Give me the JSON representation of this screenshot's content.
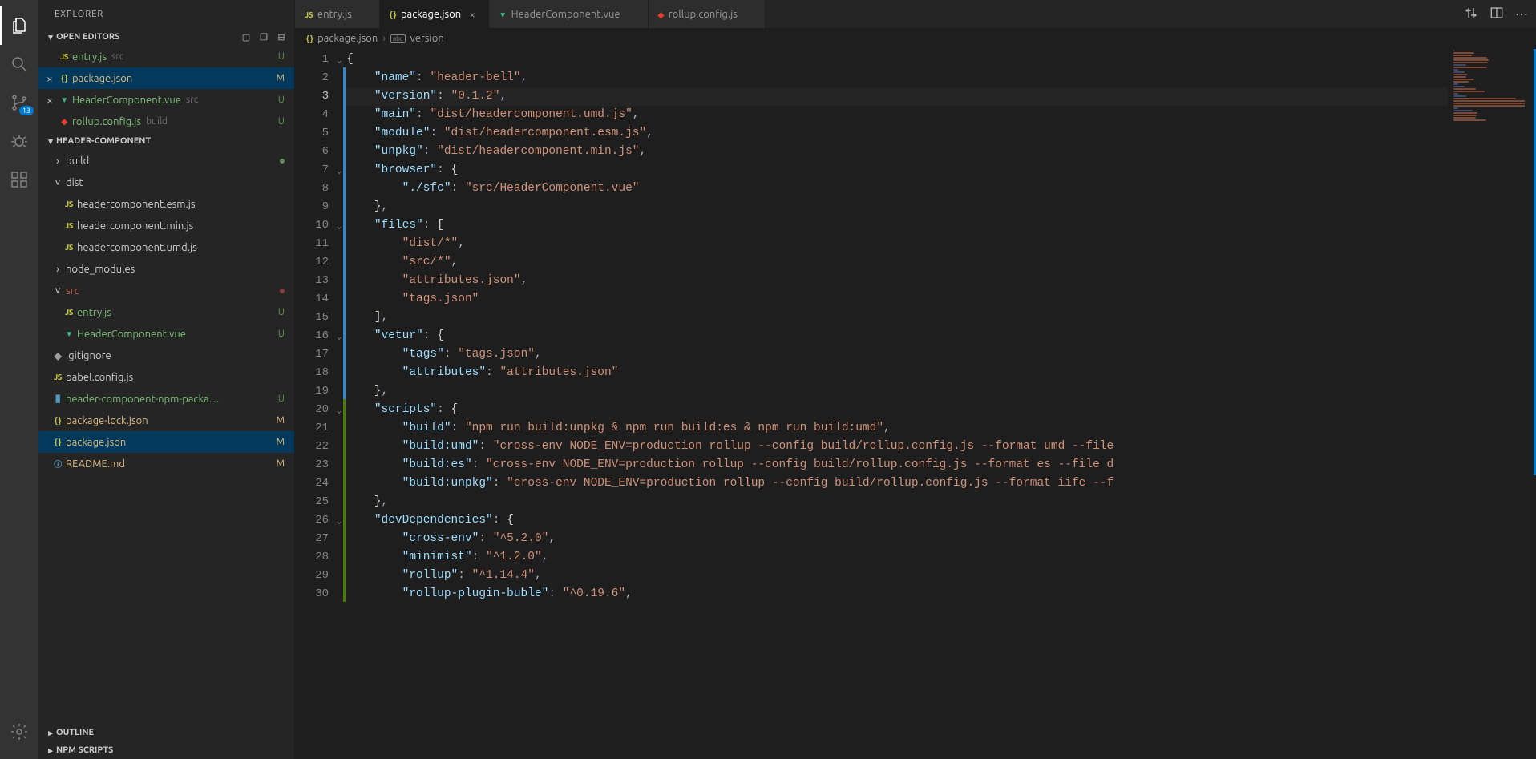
{
  "sidebar": {
    "title": "EXPLORER",
    "sections": {
      "openEditors": {
        "label": "OPEN EDITORS",
        "items": [
          {
            "icon": "js",
            "label": "entry.js",
            "hint": "src",
            "status": "U",
            "close": false
          },
          {
            "icon": "json",
            "label": "package.json",
            "hint": "",
            "status": "M",
            "close": true
          },
          {
            "icon": "vue",
            "label": "HeaderComponent.vue",
            "hint": "src",
            "status": "U",
            "close": true
          },
          {
            "icon": "rollup",
            "label": "rollup.config.js",
            "hint": "build",
            "status": "U",
            "close": false
          }
        ]
      },
      "project": {
        "label": "HEADER-COMPONENT",
        "tree": [
          {
            "depth": 0,
            "kind": "folder-closed",
            "label": "build",
            "statusKind": "dot-green"
          },
          {
            "depth": 0,
            "kind": "folder-open",
            "label": "dist"
          },
          {
            "depth": 1,
            "kind": "file",
            "icon": "js",
            "label": "headercomponent.esm.js"
          },
          {
            "depth": 1,
            "kind": "file",
            "icon": "js",
            "label": "headercomponent.min.js"
          },
          {
            "depth": 1,
            "kind": "file",
            "icon": "js",
            "label": "headercomponent.umd.js"
          },
          {
            "depth": 0,
            "kind": "folder-closed",
            "label": "node_modules"
          },
          {
            "depth": 0,
            "kind": "folder-open",
            "label": "src",
            "color": "maroon",
            "statusKind": "dot-maroon"
          },
          {
            "depth": 1,
            "kind": "file",
            "icon": "js",
            "label": "entry.js",
            "color": "green",
            "status": "U"
          },
          {
            "depth": 1,
            "kind": "file",
            "icon": "vue",
            "label": "HeaderComponent.vue",
            "color": "green",
            "status": "U"
          },
          {
            "depth": 0,
            "kind": "file",
            "icon": "git",
            "label": ".gitignore"
          },
          {
            "depth": 0,
            "kind": "file",
            "icon": "js",
            "label": "babel.config.js"
          },
          {
            "depth": 0,
            "kind": "file",
            "icon": "md",
            "label": "header-component-npm-packa…",
            "color": "green",
            "status": "U"
          },
          {
            "depth": 0,
            "kind": "file",
            "icon": "json",
            "label": "package-lock.json",
            "color": "amber",
            "status": "M"
          },
          {
            "depth": 0,
            "kind": "file",
            "icon": "json",
            "label": "package.json",
            "color": "amber",
            "status": "M",
            "selected": true
          },
          {
            "depth": 0,
            "kind": "file",
            "icon": "info",
            "label": "README.md",
            "color": "amber",
            "status": "M"
          }
        ]
      },
      "outline": {
        "label": "OUTLINE"
      },
      "npmScripts": {
        "label": "NPM SCRIPTS"
      }
    }
  },
  "activityBar": {
    "scmBadge": "13"
  },
  "tabs": [
    {
      "icon": "js",
      "label": "entry.js",
      "active": false,
      "close": false
    },
    {
      "icon": "json",
      "label": "package.json",
      "active": true,
      "close": true
    },
    {
      "icon": "vue",
      "label": "HeaderComponent.vue",
      "active": false,
      "close": false
    },
    {
      "icon": "rollup",
      "label": "rollup.config.js",
      "active": false,
      "close": false
    }
  ],
  "breadcrumb": {
    "fileIcon": "json",
    "file": "package.json",
    "symbolIcon": "abc",
    "symbol": "version"
  },
  "code": {
    "firstLine": 1,
    "currentLine": 3,
    "dirtyBar": [
      {
        "from": 2,
        "to": 19,
        "color": "#2e8ad0"
      },
      {
        "from": 20,
        "to": 30,
        "color": "#487e02"
      }
    ],
    "lines": [
      [
        [
          "br",
          "{"
        ]
      ],
      [
        [
          "br",
          "    "
        ],
        [
          "k",
          "\"name\""
        ],
        [
          "p",
          ": "
        ],
        [
          "s",
          "\"header-bell\""
        ],
        [
          "p",
          ","
        ]
      ],
      [
        [
          "br",
          "    "
        ],
        [
          "k",
          "\"version\""
        ],
        [
          "p",
          ": "
        ],
        [
          "s",
          "\"0.1.2\""
        ],
        [
          "p",
          ","
        ]
      ],
      [
        [
          "br",
          "    "
        ],
        [
          "k",
          "\"main\""
        ],
        [
          "p",
          ": "
        ],
        [
          "s",
          "\"dist/headercomponent.umd.js\""
        ],
        [
          "p",
          ","
        ]
      ],
      [
        [
          "br",
          "    "
        ],
        [
          "k",
          "\"module\""
        ],
        [
          "p",
          ": "
        ],
        [
          "s",
          "\"dist/headercomponent.esm.js\""
        ],
        [
          "p",
          ","
        ]
      ],
      [
        [
          "br",
          "    "
        ],
        [
          "k",
          "\"unpkg\""
        ],
        [
          "p",
          ": "
        ],
        [
          "s",
          "\"dist/headercomponent.min.js\""
        ],
        [
          "p",
          ","
        ]
      ],
      [
        [
          "br",
          "    "
        ],
        [
          "k",
          "\"browser\""
        ],
        [
          "p",
          ": "
        ],
        [
          "br",
          "{"
        ]
      ],
      [
        [
          "br",
          "        "
        ],
        [
          "k",
          "\"./sfc\""
        ],
        [
          "p",
          ": "
        ],
        [
          "s",
          "\"src/HeaderComponent.vue\""
        ]
      ],
      [
        [
          "br",
          "    "
        ],
        [
          "br",
          "}"
        ],
        [
          "p",
          ","
        ]
      ],
      [
        [
          "br",
          "    "
        ],
        [
          "k",
          "\"files\""
        ],
        [
          "p",
          ": "
        ],
        [
          "br",
          "["
        ]
      ],
      [
        [
          "br",
          "        "
        ],
        [
          "s",
          "\"dist/*\""
        ],
        [
          "p",
          ","
        ]
      ],
      [
        [
          "br",
          "        "
        ],
        [
          "s",
          "\"src/*\""
        ],
        [
          "p",
          ","
        ]
      ],
      [
        [
          "br",
          "        "
        ],
        [
          "s",
          "\"attributes.json\""
        ],
        [
          "p",
          ","
        ]
      ],
      [
        [
          "br",
          "        "
        ],
        [
          "s",
          "\"tags.json\""
        ]
      ],
      [
        [
          "br",
          "    "
        ],
        [
          "br",
          "]"
        ],
        [
          "p",
          ","
        ]
      ],
      [
        [
          "br",
          "    "
        ],
        [
          "k",
          "\"vetur\""
        ],
        [
          "p",
          ": "
        ],
        [
          "br",
          "{"
        ]
      ],
      [
        [
          "br",
          "        "
        ],
        [
          "k",
          "\"tags\""
        ],
        [
          "p",
          ": "
        ],
        [
          "s",
          "\"tags.json\""
        ],
        [
          "p",
          ","
        ]
      ],
      [
        [
          "br",
          "        "
        ],
        [
          "k",
          "\"attributes\""
        ],
        [
          "p",
          ": "
        ],
        [
          "s",
          "\"attributes.json\""
        ]
      ],
      [
        [
          "br",
          "    "
        ],
        [
          "br",
          "}"
        ],
        [
          "p",
          ","
        ]
      ],
      [
        [
          "br",
          "    "
        ],
        [
          "k",
          "\"scripts\""
        ],
        [
          "p",
          ": "
        ],
        [
          "br",
          "{"
        ]
      ],
      [
        [
          "br",
          "        "
        ],
        [
          "k",
          "\"build\""
        ],
        [
          "p",
          ": "
        ],
        [
          "s",
          "\"npm run build:unpkg & npm run build:es & npm run build:umd\""
        ],
        [
          "p",
          ","
        ]
      ],
      [
        [
          "br",
          "        "
        ],
        [
          "k",
          "\"build:umd\""
        ],
        [
          "p",
          ": "
        ],
        [
          "s",
          "\"cross-env NODE_ENV=production rollup --config build/rollup.config.js --format umd --file "
        ]
      ],
      [
        [
          "br",
          "        "
        ],
        [
          "k",
          "\"build:es\""
        ],
        [
          "p",
          ": "
        ],
        [
          "s",
          "\"cross-env NODE_ENV=production rollup --config build/rollup.config.js --format es --file d"
        ]
      ],
      [
        [
          "br",
          "        "
        ],
        [
          "k",
          "\"build:unpkg\""
        ],
        [
          "p",
          ": "
        ],
        [
          "s",
          "\"cross-env NODE_ENV=production rollup --config build/rollup.config.js --format iife --f"
        ]
      ],
      [
        [
          "br",
          "    "
        ],
        [
          "br",
          "}"
        ],
        [
          "p",
          ","
        ]
      ],
      [
        [
          "br",
          "    "
        ],
        [
          "k",
          "\"devDependencies\""
        ],
        [
          "p",
          ": "
        ],
        [
          "br",
          "{"
        ]
      ],
      [
        [
          "br",
          "        "
        ],
        [
          "k",
          "\"cross-env\""
        ],
        [
          "p",
          ": "
        ],
        [
          "s",
          "\"^5.2.0\""
        ],
        [
          "p",
          ","
        ]
      ],
      [
        [
          "br",
          "        "
        ],
        [
          "k",
          "\"minimist\""
        ],
        [
          "p",
          ": "
        ],
        [
          "s",
          "\"^1.2.0\""
        ],
        [
          "p",
          ","
        ]
      ],
      [
        [
          "br",
          "        "
        ],
        [
          "k",
          "\"rollup\""
        ],
        [
          "p",
          ": "
        ],
        [
          "s",
          "\"^1.14.4\""
        ],
        [
          "p",
          ","
        ]
      ],
      [
        [
          "br",
          "        "
        ],
        [
          "k",
          "\"rollup-plugin-buble\""
        ],
        [
          "p",
          ": "
        ],
        [
          "s",
          "\"^0.19.6\""
        ],
        [
          "p",
          ","
        ]
      ]
    ],
    "foldLines": [
      1,
      7,
      10,
      16,
      20,
      26
    ]
  }
}
